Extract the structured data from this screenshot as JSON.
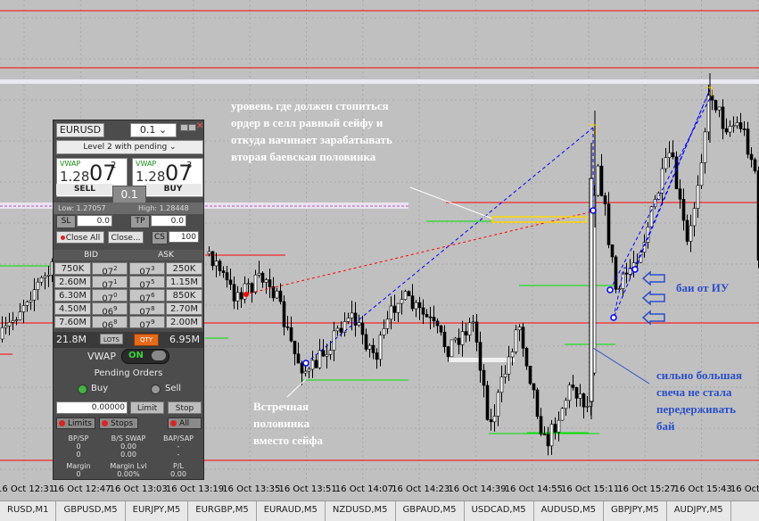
{
  "annotations": {
    "top": "уровень где должен стопиться\nордер в селл равный сейфу и\nоткуда начинает зарабатывать\nвторая баевская половинка",
    "bottom_left": "Встречная\nполовинка\nвместо сейфа",
    "buys": "баи от ИУ",
    "big_candle": "сильно большая\nсвеча не стала\nпередерживать\nбай"
  },
  "time_axis": [
    "16 Oct 12:31",
    "16 Oct 12:47",
    "16 Oct 13:03",
    "16 Oct 13:19",
    "16 Oct 13:35",
    "16 Oct 13:51",
    "16 Oct 14:07",
    "16 Oct 14:23",
    "16 Oct 14:39",
    "16 Oct 14:55",
    "16 Oct 15:11",
    "16 Oct 15:27",
    "16 Oct 15:43",
    "16 Oct 1"
  ],
  "tabs": [
    "RUSD,M1",
    "GBPUSD,M5",
    "EURJPY,M5",
    "EURGBP,M5",
    "EURAUD,M5",
    "NZDUSD,M5",
    "GBPAUD,M5",
    "USDCAD,M5",
    "AUDUSD,M5",
    "GBPJPY,M5",
    "AUDJPY,M5"
  ],
  "panel": {
    "symbol": "EURUSD",
    "lot": "0.1",
    "lot_arrow": "⌄",
    "level": "Level 2 with pending",
    "level_arrow": "⌄",
    "sell": {
      "vwap": "VWAP",
      "prefix": "1.28",
      "big": "07",
      "sup": "2",
      "label": "SELL"
    },
    "buy": {
      "vwap": "VWAP",
      "prefix": "1.28",
      "big": "07",
      "sup": "3",
      "label": "BUY"
    },
    "lot_badge": "0.1",
    "low": "Low: 1.27057",
    "high": "High: 1.28448",
    "sl_label": "SL",
    "sl_value": "0.0",
    "tp_label": "TP",
    "tp_value": "0.0",
    "close_all": "Close All",
    "close_dots": "Close...",
    "cs_label": "CS",
    "cs_value": "100",
    "bid_label": "BID",
    "ask_label": "ASK",
    "depth": [
      {
        "bid_vol": "750K",
        "bid": "07",
        "bid_sub": "2",
        "ask": "07",
        "ask_sub": "3",
        "ask_vol": "250K"
      },
      {
        "bid_vol": "2.60M",
        "bid": "07",
        "bid_sub": "1",
        "ask": "07",
        "ask_sub": "5",
        "ask_vol": "1.15M"
      },
      {
        "bid_vol": "6.30M",
        "bid": "07",
        "bid_sub": "0",
        "ask": "07",
        "ask_sub": "6",
        "ask_vol": "850K"
      },
      {
        "bid_vol": "4.50M",
        "bid": "06",
        "bid_sub": "9",
        "ask": "07",
        "ask_sub": "8",
        "ask_vol": "2.70M"
      },
      {
        "bid_vol": "7.60M",
        "bid": "06",
        "bid_sub": "8",
        "ask": "07",
        "ask_sub": "9",
        "ask_vol": "2.00M"
      }
    ],
    "total_bid": "21.8M",
    "lots_btn": "LOTS",
    "qty_btn": "QTY",
    "total_ask": "6.95M",
    "vwap_label": "VWAP",
    "vwap_toggle": "ON",
    "pending_title": "Pending Orders",
    "buy_radio": "Buy",
    "sell_radio": "Sell",
    "pending_price": "0.00000",
    "limit_btn": "Limit",
    "stop_btn": "Stop",
    "limits_btn": "Limits",
    "stops_btn": "Stops",
    "all_btn": "All",
    "stats": {
      "h1": "BP/SP",
      "h2": "B/S SWAP",
      "h3": "BAP/SAP",
      "r1": "0",
      "r2": "0.00",
      "r3": "-",
      "s1": "0",
      "s2": "0.00",
      "s3": "-",
      "m1": "Margin",
      "m2": "Margin Lvl",
      "m3": "P/L",
      "v1": "0",
      "v2": "0.00%",
      "v3": "0.00"
    }
  },
  "colors": {
    "chart_bg": "#c0c0c0",
    "resistance": "#ff0000",
    "trend_blue": "#0000ff",
    "level_green": "#00e000",
    "yellow_box": "#ffd800",
    "annotation_blue": "#2a4fc9"
  }
}
